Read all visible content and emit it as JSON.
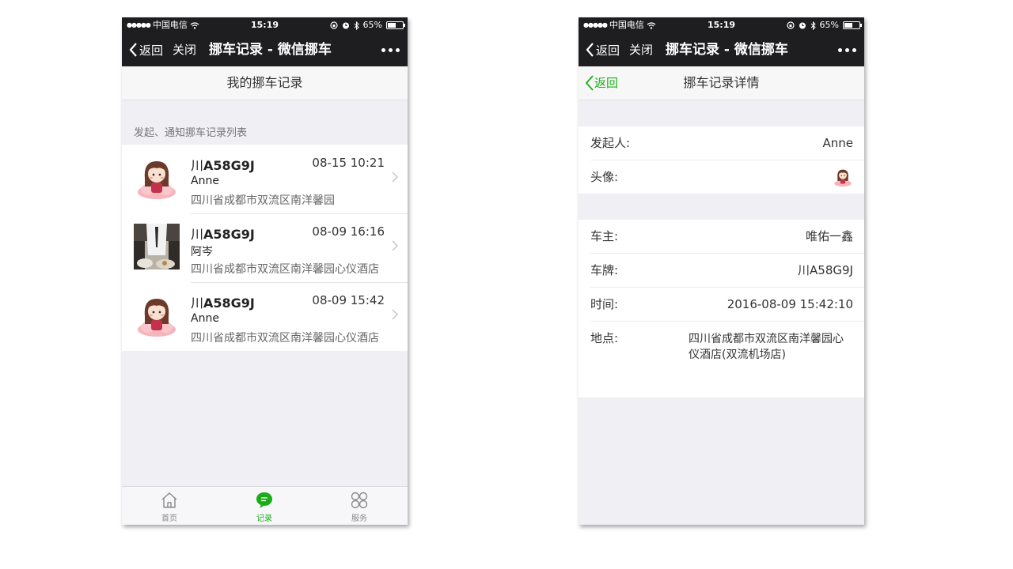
{
  "status_bar": {
    "signal": "●●●●●",
    "carrier": "中国电信",
    "time": "15:19",
    "battery_text": "65%",
    "battery_level": 0.65
  },
  "left": {
    "nav": {
      "back": "返回",
      "close": "关闭",
      "title": "挪车记录 - 微信挪车"
    },
    "header_title": "我的挪车记录",
    "section_label": "发起、通知挪车记录列表",
    "records": [
      {
        "plate_prefix": "川",
        "plate": "A58G9J",
        "time": "08-15 10:21",
        "name": "Anne",
        "address": "四川省成都市双流区南洋馨园",
        "avatar": "cartoon-girl-avatar"
      },
      {
        "plate_prefix": "川",
        "plate": "A58G9J",
        "time": "08-09 16:16",
        "name": "阿岑",
        "address": "四川省成都市双流区南洋馨园心仪酒店",
        "avatar": "photo-avatar"
      },
      {
        "plate_prefix": "川",
        "plate": "A58G9J",
        "time": "08-09 15:42",
        "name": "Anne",
        "address": "四川省成都市双流区南洋馨园心仪酒店",
        "avatar": "cartoon-girl-avatar"
      }
    ],
    "tabs": [
      {
        "label": "首页",
        "icon": "home-icon"
      },
      {
        "label": "记录",
        "icon": "chat-record-icon",
        "active": true
      },
      {
        "label": "服务",
        "icon": "services-icon"
      }
    ]
  },
  "right": {
    "nav": {
      "back": "返回",
      "close": "关闭",
      "title": "挪车记录 - 微信挪车"
    },
    "header_back": "返回",
    "header_title": "挪车记录详情",
    "initiator_label": "发起人:",
    "initiator_value": "Anne",
    "avatar_label": "头像:",
    "owner_label": "车主:",
    "owner_value": "唯佑一鑫",
    "plate_label": "车牌:",
    "plate_value": "川A58G9J",
    "time_label": "时间:",
    "time_value": "2016-08-09 15:42:10",
    "location_label": "地点:",
    "location_value": "四川省成都市双流区南洋馨园心仪酒店(双流机场店)"
  },
  "colors": {
    "accent": "#1aad19",
    "navbar": "#1e1e21",
    "background": "#efeff4"
  }
}
